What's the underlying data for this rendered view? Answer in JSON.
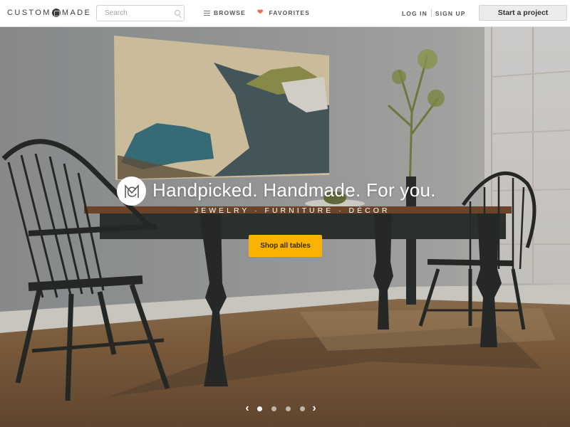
{
  "header": {
    "logo_left": "CUSTOM",
    "logo_right": "MADE",
    "search_placeholder": "Search",
    "browse_label": "BROWSE",
    "favorites_label": "FAVORITES",
    "login_label": "LOG IN",
    "signup_label": "SIGN UP",
    "start_project_label": "Start a project"
  },
  "hero": {
    "headline": "Handpicked. Handmade. For you.",
    "subline": "JEWELRY · FURNITURE · DÉCOR",
    "cta_label": "Shop all tables",
    "carousel": {
      "total_slides": 4,
      "active_slide": 1,
      "prev_icon": "‹",
      "next_icon": "›"
    }
  },
  "colors": {
    "cta": "#f9b200",
    "heart": "#ef6a4c",
    "text": "#555555"
  }
}
